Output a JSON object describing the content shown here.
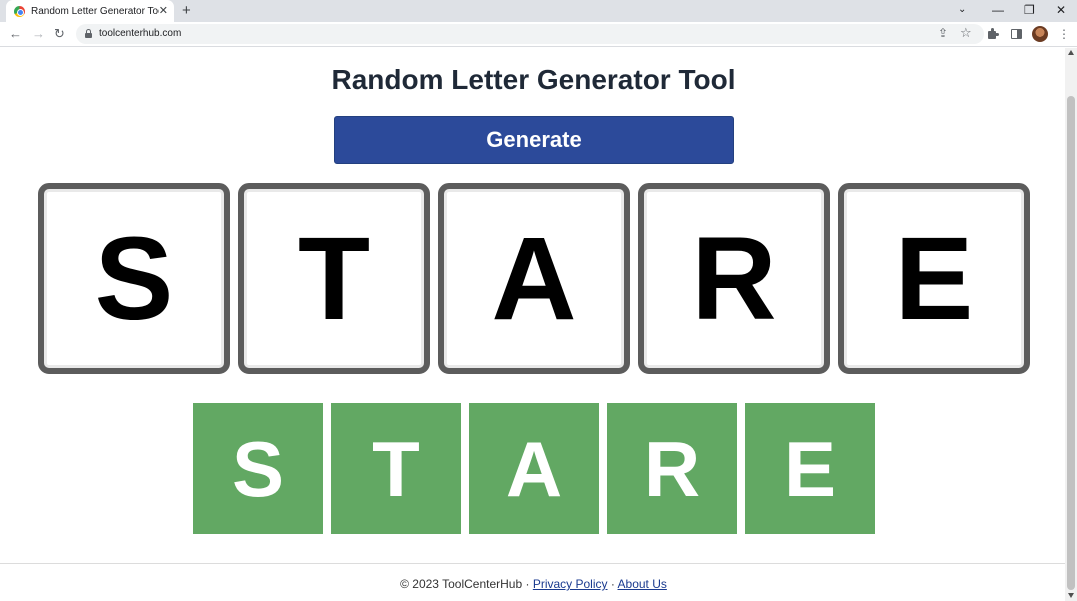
{
  "browser": {
    "tab_title": "Random Letter Generator Tool",
    "url": "toolcenterhub.com",
    "new_tab_symbol": "+",
    "tab_close_symbol": "✕",
    "window_controls": {
      "minimize": "—",
      "restore": "❐",
      "close": "✕"
    },
    "nav": {
      "back": "←",
      "forward": "→",
      "reload": "↻"
    },
    "icons": [
      "favicon-chrome-icon",
      "lock-icon",
      "share-icon",
      "star-icon",
      "extensions-icon",
      "side-panel-icon",
      "avatar",
      "more-menu-icon"
    ]
  },
  "page": {
    "title": "Random Letter Generator Tool",
    "generate_label": "Generate",
    "letters": [
      "S",
      "T",
      "A",
      "R",
      "E"
    ],
    "tile_colors": {
      "big_border": "#5c5c5c",
      "small_fill": "#62a863",
      "button": "#2c4a9a"
    }
  },
  "footer": {
    "copyright": "© 2023 ToolCenterHub · ",
    "privacy_label": "Privacy Policy",
    "separator": " · ",
    "about_label": "About Us"
  }
}
